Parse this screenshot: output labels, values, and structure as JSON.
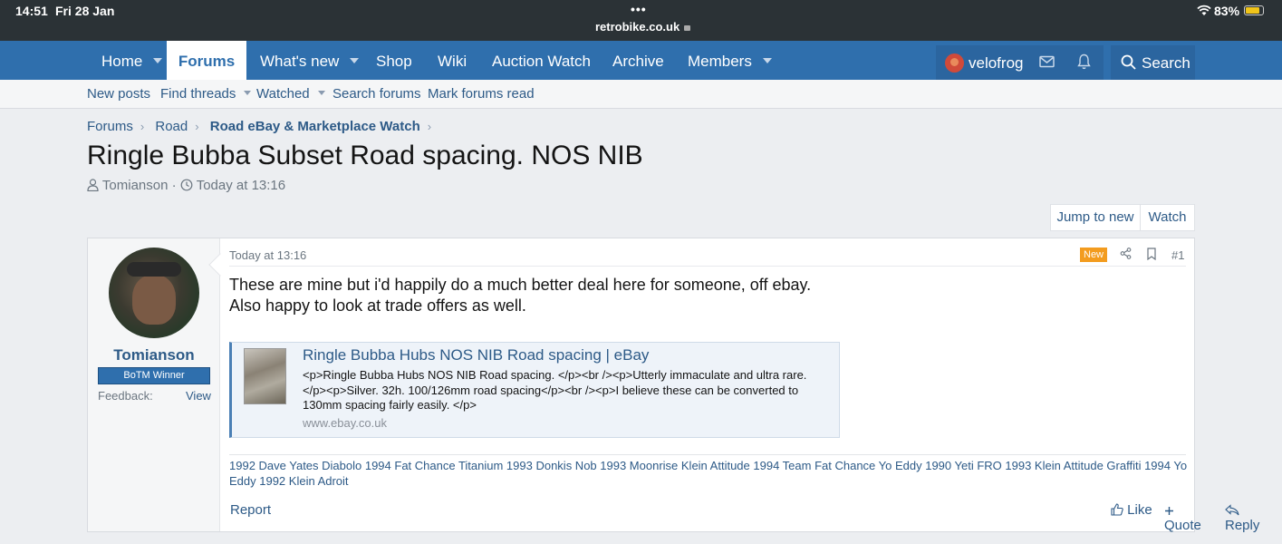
{
  "status_bar": {
    "time": "14:51",
    "date": "Fri 28 Jan",
    "dots": "•••",
    "url": "retrobike.co.uk",
    "battery": "83%",
    "battery_level": 0.83
  },
  "nav": {
    "home": "Home",
    "forums": "Forums",
    "whats_new": "What's new",
    "shop": "Shop",
    "wiki": "Wiki",
    "auction_watch": "Auction Watch",
    "archive": "Archive",
    "members": "Members",
    "username": "velofrog",
    "search": "Search"
  },
  "subnav": {
    "new_posts": "New posts",
    "find_threads": "Find threads",
    "watched": "Watched",
    "search_forums": "Search forums",
    "mark_read": "Mark forums read"
  },
  "breadcrumb": {
    "forums": "Forums",
    "road": "Road",
    "section": "Road eBay & Marketplace Watch"
  },
  "thread": {
    "title": "Ringle Bubba Subset Road spacing. NOS NIB",
    "author": "Tomianson",
    "separator": "·",
    "date": "Today at 13:16",
    "jump_to_new": "Jump to new",
    "watch": "Watch"
  },
  "post": {
    "user": {
      "name": "Tomianson",
      "badge": "BoTM Winner",
      "feedback_label": "Feedback:",
      "feedback_link": "View"
    },
    "date": "Today at 13:16",
    "new_badge": "New",
    "number": "#1",
    "body_line1": "These are mine but i'd happily do a much better deal here for someone, off ebay.",
    "body_line2": "Also happy to look at trade offers as well.",
    "embed": {
      "title": "Ringle Bubba Hubs NOS NIB Road spacing | eBay",
      "description": "<p>Ringle Bubba Hubs NOS NIB Road spacing. </p><br /><p>Utterly immaculate and ultra rare.</p><p>Silver. 32h. 100/126mm road spacing</p><br /><p>I believe these can be converted to 130mm spacing fairly easily. </p>",
      "domain": "www.ebay.co.uk"
    },
    "signature": "1992 Dave Yates Diabolo 1994 Fat Chance Titanium 1993 Donkis Nob 1993 Moonrise Klein Attitude 1994 Team Fat Chance Yo Eddy 1990 Yeti FRO 1993 Klein Attitude Graffiti 1994 Yo Eddy 1992 Klein Adroit",
    "report": "Report",
    "like": "Like",
    "quote": "Quote",
    "reply": "Reply"
  },
  "colors": {
    "nav_bg": "#2f6fad",
    "link": "#2d5a87",
    "new_badge": "#f39c1f",
    "status_bar": "#2b3236"
  }
}
